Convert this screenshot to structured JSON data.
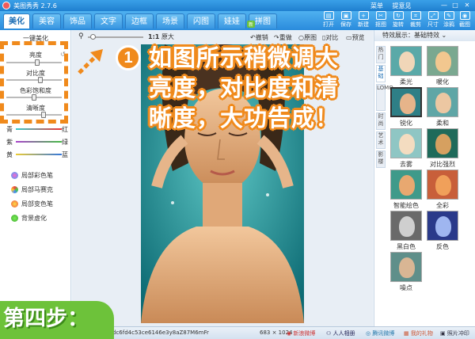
{
  "titlebar": {
    "title": "美图秀秀 2.7.6",
    "links": [
      "菜单",
      "提意见"
    ],
    "min": "—",
    "max": "□",
    "close": "✕"
  },
  "tabs": [
    "美化",
    "美容",
    "饰品",
    "文字",
    "边框",
    "场景",
    "闪图",
    "娃娃",
    "拼图"
  ],
  "active_tab": "美化",
  "new_badge": "新",
  "toolbar": [
    "打开",
    "保存",
    "新建",
    "抠图",
    "旋转",
    "裁剪",
    "尺寸",
    "涂鸦",
    "截图"
  ],
  "left": {
    "top_label": "一键美化",
    "sliders": [
      "亮度",
      "对比度",
      "色彩饱和度",
      "清晰度"
    ],
    "color_rows": [
      {
        "left": "青",
        "right": "红"
      },
      {
        "left": "紫",
        "right": "绿"
      },
      {
        "left": "黄",
        "right": "蓝"
      }
    ],
    "tools": [
      "局部彩色笔",
      "局部马赛克",
      "局部变色笔",
      "背景虚化"
    ]
  },
  "canvas_toolbar": {
    "ratio": "1:1",
    "zoom": "原大",
    "undo": "撤销",
    "redo": "重做",
    "original": "原图",
    "compare": "对比",
    "preview": "预览"
  },
  "right": {
    "header": "特效展示：基础特效",
    "vtabs": [
      "热门",
      "基础",
      "LOMO",
      "时尚",
      "艺术",
      "影楼"
    ],
    "effects": [
      "柔光",
      "暖化",
      "锐化",
      "柔和",
      "去雾",
      "对比强烈",
      "智能绘色",
      "全彩",
      "黑白色",
      "反色",
      "噪点"
    ]
  },
  "status": {
    "hash": "dc6fd4c53ce6146e3y8aZ87M6mFr",
    "size": "683 × 1024",
    "items": [
      "新浪微博",
      "人人相册",
      "腾讯微博",
      "我的礼物",
      "照片冲印"
    ]
  },
  "overlay": {
    "step_number": "1",
    "instruction": "如图所示稍微调大亮度，对比度和清晰度，大功告成！",
    "step_label": "第四步："
  },
  "colors": {
    "accent": "#f08a1c",
    "step_green": "#6dc23a",
    "title_blue": "#2a8bdc"
  }
}
